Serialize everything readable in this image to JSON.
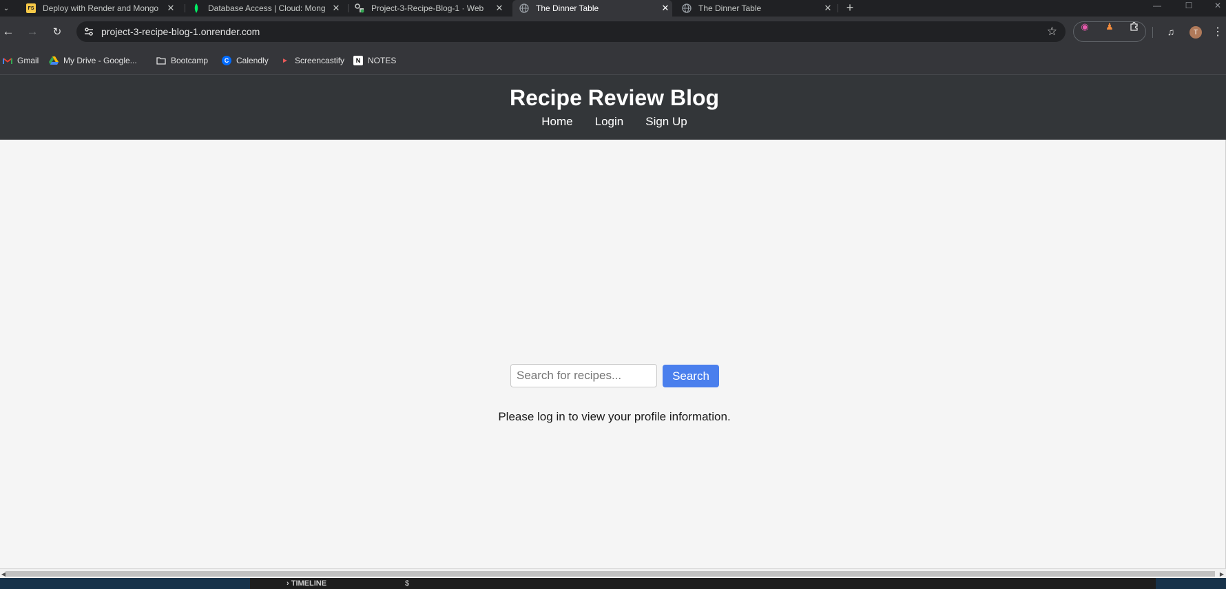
{
  "browser": {
    "tabs": [
      {
        "title": "Deploy with Render and Mongo",
        "favicon_text": "FS",
        "favicon_color": "#f7c948",
        "active": false
      },
      {
        "title": "Database Access | Cloud: Mong",
        "favicon_text": "",
        "favicon_color": "#00ed64",
        "active": false
      },
      {
        "title": "Project-3-Recipe-Blog-1 · Web",
        "favicon_text": "",
        "favicon_color": "#c4c7c5",
        "active": false
      },
      {
        "title": "The Dinner Table",
        "favicon_text": "",
        "favicon_color": "#9aa0a6",
        "active": true
      },
      {
        "title": "The Dinner Table",
        "favicon_text": "",
        "favicon_color": "#9aa0a6",
        "active": false
      }
    ],
    "address": "project-3-recipe-blog-1.onrender.com",
    "bookmarks": [
      {
        "label": "Gmail",
        "icon": "gmail-icon"
      },
      {
        "label": "My Drive - Google...",
        "icon": "google-drive-icon"
      },
      {
        "label": "Bootcamp",
        "icon": "folder-icon"
      },
      {
        "label": "Calendly",
        "icon": "calendly-icon"
      },
      {
        "label": "Screencastify",
        "icon": "screencastify-icon"
      },
      {
        "label": "NOTES",
        "icon": "notion-icon"
      }
    ],
    "profile_initial": "T"
  },
  "site": {
    "title": "Recipe Review Blog",
    "nav": [
      "Home",
      "Login",
      "Sign Up"
    ],
    "search_placeholder": "Search for recipes...",
    "search_button": "Search",
    "login_message": "Please log in to view your profile information."
  },
  "behind_window": {
    "timeline_label": "TIMELINE",
    "prompt": "$"
  }
}
